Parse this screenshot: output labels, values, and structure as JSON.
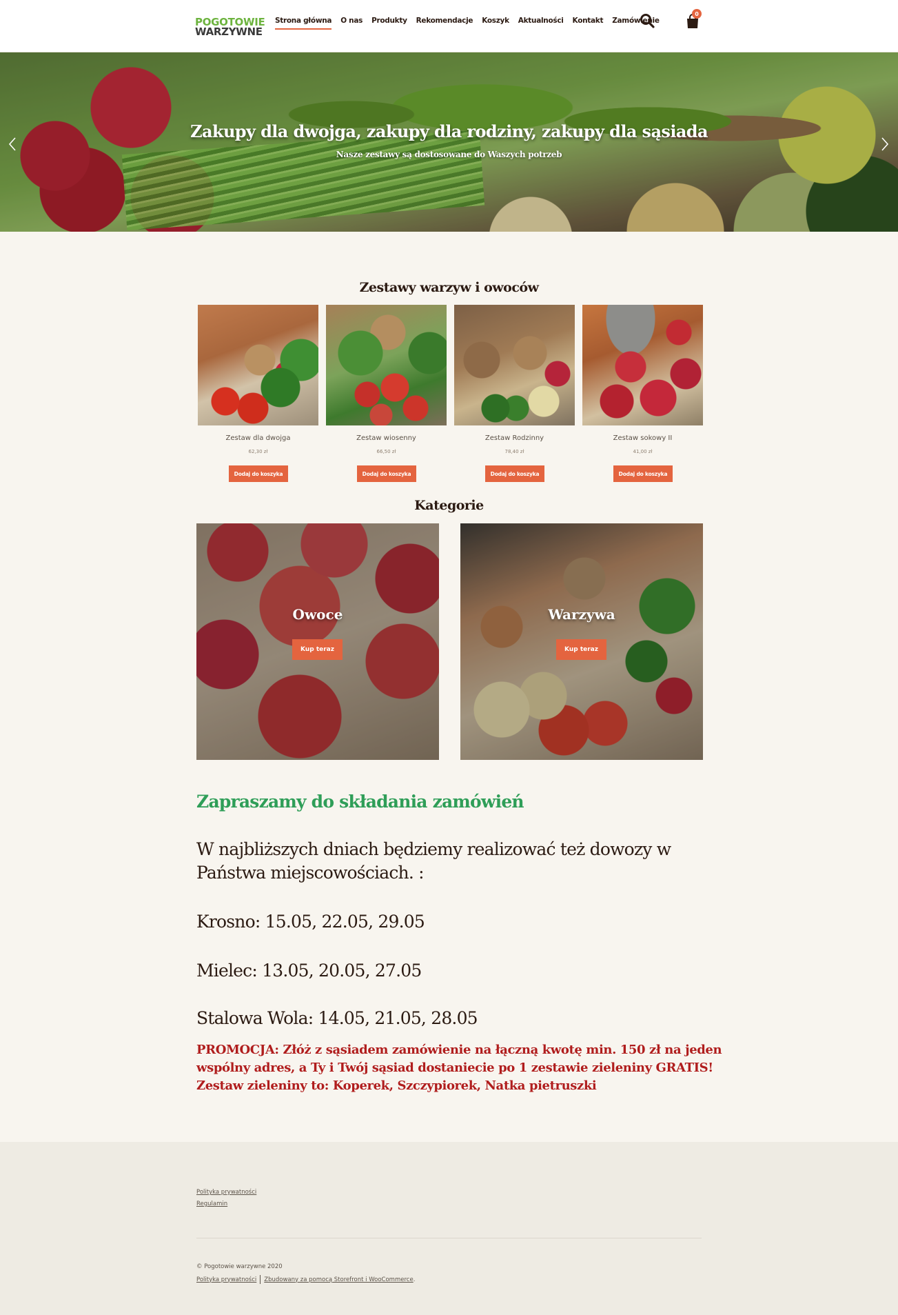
{
  "header": {
    "logo": {
      "line1": "POGOTOWIE",
      "line2": "WARZYWNE"
    },
    "nav": [
      {
        "label": "Strona główna",
        "active": true
      },
      {
        "label": "O nas"
      },
      {
        "label": "Produkty"
      },
      {
        "label": "Rekomendacje"
      },
      {
        "label": "Koszyk"
      },
      {
        "label": "Aktualności"
      },
      {
        "label": "Kontakt"
      },
      {
        "label": "Zamówienie"
      }
    ],
    "search_icon": "search-icon",
    "cart_icon": "shopping-bag-icon",
    "cart_count": "0"
  },
  "hero": {
    "title": "Zakupy dla dwojga, zakupy dla rodziny, zakupy dla sąsiada",
    "subtitle": "Nasze zestawy są dostosowane do Waszych potrzeb"
  },
  "products_section": {
    "title": "Zestawy warzyw i owoców",
    "items": [
      {
        "name": "Zestaw dla dwojga",
        "price": "62,30 zł",
        "button": "Dodaj do koszyka"
      },
      {
        "name": "Zestaw wiosenny",
        "price": "66,50 zł",
        "button": "Dodaj do koszyka"
      },
      {
        "name": "Zestaw Rodzinny",
        "price": "78,40 zł",
        "button": "Dodaj do koszyka"
      },
      {
        "name": "Zestaw sokowy II",
        "price": "41,00 zł",
        "button": "Dodaj do koszyka"
      }
    ]
  },
  "categories_section": {
    "title": "Kategorie",
    "items": [
      {
        "name": "Owoce",
        "button": "Kup teraz"
      },
      {
        "name": "Warzywa",
        "button": "Kup teraz"
      }
    ]
  },
  "announcement": {
    "invite": "Zapraszamy do składania zamówień",
    "delivery_line1": "W najbliższych dniach będziemy realizować też dowozy w",
    "delivery_line2": "Państwa miejscowościach. :",
    "cities": [
      "Krosno: 15.05, 22.05, 29.05",
      "Mielec: 13.05, 20.05, 27.05",
      "Stalowa Wola: 14.05, 21.05, 28.05"
    ],
    "promo_line1": "PROMOCJA: Złóż z sąsiadem zamówienie na łączną kwotę min. 150 zł na jeden",
    "promo_line2": "wspólny adres, a Ty i Twój sąsiad dostaniecie po 1 zestawie zieleniny GRATIS!",
    "promo_line3": "Zestaw zieleniny to: Koperek, Szczypiorek, Natka pietruszki"
  },
  "footer": {
    "links": [
      "Polityka prywatności",
      "Regulamin"
    ],
    "copyright": "© Pogotowie warzywne 2020",
    "credits_privacy": "Polityka prywatności",
    "credits_built": "Zbudowany za pomocą Storefront i WooCommerce",
    "credits_dot": "."
  },
  "colors": {
    "accent": "#e4643f",
    "green_heading": "#2f9e58",
    "promo_red": "#b01d1d",
    "page_bg": "#f8f5ef",
    "footer_bg": "#eeebe3"
  }
}
